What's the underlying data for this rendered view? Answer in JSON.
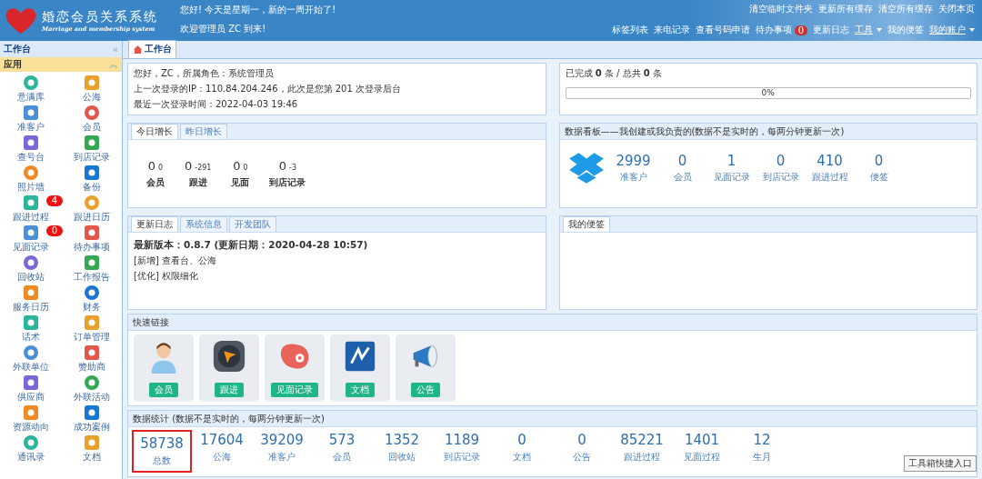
{
  "header": {
    "logo_title": "婚恋会员关系系统",
    "logo_subtitle": "Marriage and membership system",
    "greeting": "您好! 今天是星期一，新的一周开始了!",
    "welcome": "欢迎管理员 ZC 到来!",
    "links_top": [
      "清空临时文件夹",
      "更新所有缓存",
      "清空所有缓存",
      "关闭本页"
    ],
    "links_bottom": [
      {
        "label": "标签列表",
        "kind": "link"
      },
      {
        "label": "来电记录",
        "kind": "link"
      },
      {
        "label": "查看号码申请",
        "kind": "link"
      },
      {
        "label": "待办事项",
        "kind": "badge",
        "badge": "0"
      },
      {
        "label": "更新日志",
        "kind": "link"
      },
      {
        "label": "工具",
        "kind": "menu"
      },
      {
        "label": "我的便签",
        "kind": "link"
      },
      {
        "label": "我的账户",
        "kind": "menu"
      }
    ]
  },
  "sidebar": {
    "title": "工作台",
    "collapse": "«",
    "section": "应用",
    "section_toggle": "︽",
    "items": [
      {
        "label": "意满库"
      },
      {
        "label": "公海"
      },
      {
        "label": "准客户"
      },
      {
        "label": "会员"
      },
      {
        "label": "查号台"
      },
      {
        "label": "到店记录"
      },
      {
        "label": "照片墙"
      },
      {
        "label": "备份"
      },
      {
        "label": "跟进过程",
        "badge": "4"
      },
      {
        "label": "跟进日历"
      },
      {
        "label": "见面记录",
        "badge": "0"
      },
      {
        "label": "待办事项"
      },
      {
        "label": "回收站"
      },
      {
        "label": "工作报告"
      },
      {
        "label": "服务日历"
      },
      {
        "label": "财务"
      },
      {
        "label": "话术"
      },
      {
        "label": "订单管理"
      },
      {
        "label": "外联单位"
      },
      {
        "label": "赞助商"
      },
      {
        "label": "供应商"
      },
      {
        "label": "外联活动"
      },
      {
        "label": "资源动向"
      },
      {
        "label": "成功案例"
      },
      {
        "label": "通讯录"
      },
      {
        "label": "文档"
      }
    ]
  },
  "tabs": [
    {
      "label": "工作台",
      "selected": true
    }
  ],
  "profile": {
    "lines": [
      "您好，ZC，所属角色：系统管理员",
      "上一次登录的IP：110.84.204.246，此次是您第 201 次登录后台",
      "最近一次登录时间：2022-04-03 19:46"
    ]
  },
  "tasks": {
    "summary": "已完成 **0** 条 / 总共 **0** 条",
    "level": 0,
    "reading": "0%"
  },
  "growth": {
    "tabs": [
      {
        "label": "今日增长",
        "selected": true
      },
      {
        "label": "昨日增长",
        "selected": false
      }
    ],
    "items": [
      {
        "value": "0",
        "delta": "0",
        "label": "会员"
      },
      {
        "value": "0",
        "delta": "-291",
        "label": "跟进"
      },
      {
        "value": "0",
        "delta": "0",
        "label": "见面"
      },
      {
        "value": "0",
        "delta": "-3",
        "label": "到店记录"
      }
    ]
  },
  "board": {
    "title": "数据看板——我创建或我负责的(数据不是实时的，每两分钟更新一次)",
    "items": [
      {
        "value": "2999",
        "label": "准客户"
      },
      {
        "value": "0",
        "label": "会员"
      },
      {
        "value": "1",
        "label": "见面记录"
      },
      {
        "value": "0",
        "label": "到店记录"
      },
      {
        "value": "410",
        "label": "跟进过程"
      },
      {
        "value": "0",
        "label": "便签"
      }
    ]
  },
  "log": {
    "tabs": [
      {
        "label": "更新日志",
        "selected": true
      },
      {
        "label": "系统信息",
        "selected": false
      },
      {
        "label": "开发团队",
        "selected": false
      }
    ],
    "version": "最新版本：0.8.7 (更新日期：2020-04-28 10:57)",
    "entries": [
      "[新增] 查看台、公海",
      "[优化] 权限细化"
    ]
  },
  "notes": {
    "tabs": [
      {
        "label": "我的便签",
        "selected": true
      }
    ]
  },
  "quick": {
    "title": "快速链接",
    "items": [
      {
        "label": "会员",
        "kind": "person"
      },
      {
        "label": "跟进",
        "kind": "compass"
      },
      {
        "label": "见面记录",
        "kind": "meat"
      },
      {
        "label": "文档",
        "kind": "doc"
      },
      {
        "label": "公告",
        "kind": "horn"
      }
    ]
  },
  "stats": {
    "title": "数据统计 (数据不是实时的，每两分钟更新一次)",
    "items": [
      {
        "value": "58738",
        "label": "总数",
        "highlighted": true
      },
      {
        "value": "17604",
        "label": "公海",
        "highlighted": false
      },
      {
        "value": "39209",
        "label": "准客户",
        "highlighted": false
      },
      {
        "value": "573",
        "label": "会员",
        "highlighted": false
      },
      {
        "value": "1352",
        "label": "回收站",
        "highlighted": false
      },
      {
        "value": "1189",
        "label": "到店记录",
        "highlighted": false
      },
      {
        "value": "0",
        "label": "文档",
        "highlighted": false
      },
      {
        "value": "0",
        "label": "公告",
        "highlighted": false
      },
      {
        "value": "85221",
        "label": "跟进过程",
        "highlighted": false
      },
      {
        "value": "1401",
        "label": "见面过程",
        "highlighted": false
      },
      {
        "value": "12",
        "label": "生月",
        "highlighted": false
      }
    ]
  },
  "toolbox": "工具箱快捷入口"
}
